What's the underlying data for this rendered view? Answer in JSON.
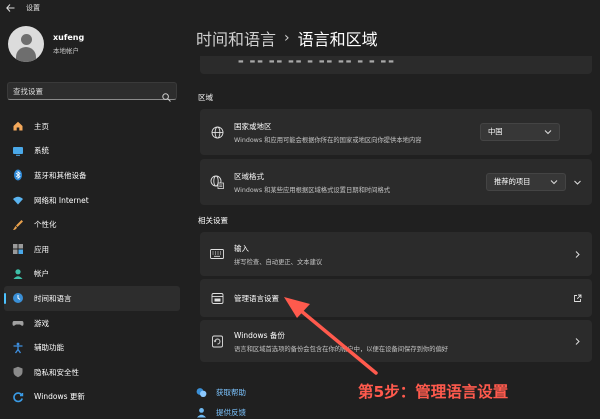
{
  "window": {
    "title": "设置"
  },
  "profile": {
    "name": "xufeng",
    "account_type": "本地帐户"
  },
  "search": {
    "placeholder": "查找设置"
  },
  "sidebar": {
    "items": [
      {
        "label": "主页",
        "icon": "home-icon"
      },
      {
        "label": "系统",
        "icon": "system-icon"
      },
      {
        "label": "蓝牙和其他设备",
        "icon": "bluetooth-icon"
      },
      {
        "label": "网络和 Internet",
        "icon": "wifi-icon"
      },
      {
        "label": "个性化",
        "icon": "brush-icon"
      },
      {
        "label": "应用",
        "icon": "apps-icon"
      },
      {
        "label": "帐户",
        "icon": "person-icon"
      },
      {
        "label": "时间和语言",
        "icon": "time-language-icon",
        "selected": true
      },
      {
        "label": "游戏",
        "icon": "gamepad-icon"
      },
      {
        "label": "辅助功能",
        "icon": "accessibility-icon"
      },
      {
        "label": "隐私和安全性",
        "icon": "shield-icon"
      },
      {
        "label": "Windows 更新",
        "icon": "update-icon"
      }
    ]
  },
  "breadcrumb": {
    "parent": "时间和语言",
    "separator": "›",
    "current": "语言和区域"
  },
  "region_section": {
    "title": "区域",
    "country": {
      "title": "国家或地区",
      "description": "Windows 和应用可能会根据你所在的国家或地区向你提供本地内容",
      "value": "中国"
    },
    "format": {
      "title": "区域格式",
      "description": "Windows 和某些应用根据区域格式设置日期和时间格式",
      "value": "推荐的项目"
    }
  },
  "related_section": {
    "title": "相关设置",
    "items": [
      {
        "title": "输入",
        "description": "拼写检查、自动更正、文本建议",
        "icon": "keyboard-icon"
      },
      {
        "title": "管理语言设置",
        "description": "",
        "icon": "admin-language-icon"
      },
      {
        "title": "Windows 备份",
        "description": "语言和区域首选项的备份会包含在你的帐户中，以便在设备间保存到你的偏好",
        "icon": "backup-icon"
      }
    ]
  },
  "help_links": [
    {
      "label": "获取帮助",
      "icon": "help-icon"
    },
    {
      "label": "提供反馈",
      "icon": "feedback-icon"
    }
  ],
  "annotation": {
    "text": "第5步：管理语言设置",
    "color": "#ff5a4d"
  },
  "colors": {
    "accent": "#4cc2ff",
    "background": "#202020",
    "card": "#2b2b2b"
  }
}
